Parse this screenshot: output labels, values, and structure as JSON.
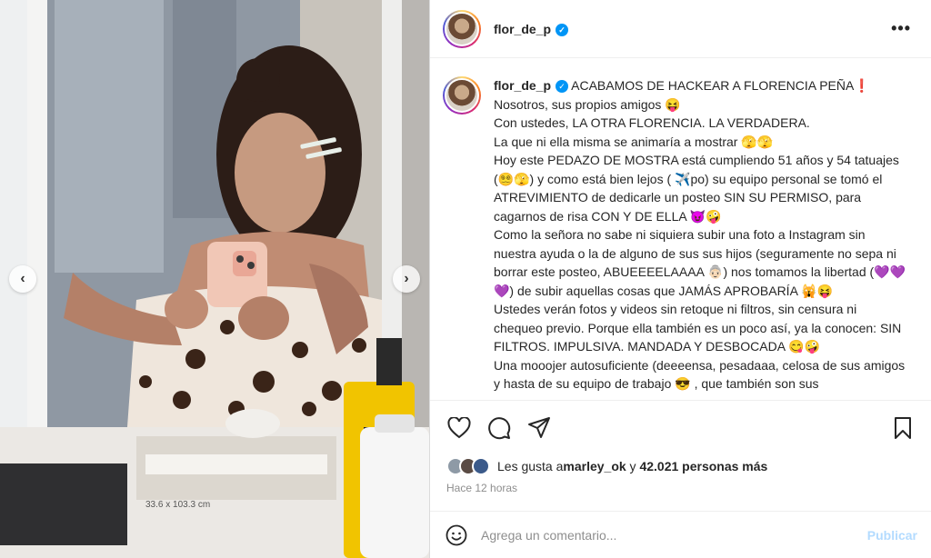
{
  "post": {
    "username": "flor_de_p",
    "more_label": "•••",
    "caption_lines": [
      "ACABAMOS DE HACKEAR A FLORENCIA PEÑA❗",
      "Nosotros, sus propios amigos 😝",
      "Con ustedes, LA OTRA FLORENCIA. LA VERDADERA.",
      "La que ni ella misma se animaría a mostrar 🫣🫣",
      "Hoy este PEDAZO DE MOSTRA está cumpliendo 51 años y 54 tatuajes (😵‍💫🫣) y como está bien lejos ( ✈️po) su equipo personal se tomó el ATREVIMIENTO de dedicarle un posteo SIN SU PERMISO, para cagarnos de risa CON Y DE ELLA 😈🤪",
      "Como la señora no sabe ni siquiera subir una foto a Instagram sin nuestra ayuda o la de alguno de sus sus hijos (seguramente no sepa ni borrar este posteo, ABUEEEELAAAA 👵🏻) nos tomamos la libertad (💜💜💜) de subir aquellas cosas que JAMÁS APROBARÍA 🙀😝",
      "Ustedes verán fotos y videos sin retoque ni filtros, sin censura ni chequeo previo. Porque ella también es un poco así, ya la conocen: SIN FILTROS. IMPULSIVA. MANDADA Y DESBOCADA 😋🤪",
      "Una mooojer autosuficiente (deeeensa, pesadaaa, celosa de sus amigos y hasta de su equipo de trabajo 😎 , que también son sus"
    ],
    "likes": {
      "prefix": "Les gusta a ",
      "user": "marley_ok",
      "middle": " y ",
      "count": "42.021 personas más"
    },
    "time": "Hace 12 horas"
  },
  "comment": {
    "placeholder": "Agrega un comentario...",
    "publish_label": "Publicar"
  },
  "media": {
    "measure_label": "33.6 x 103.3 cm",
    "prev_label": "‹",
    "next_label": "›"
  },
  "icons": {
    "like": "heart-icon",
    "comment": "comment-icon",
    "share": "share-icon",
    "save": "bookmark-icon",
    "emoji": "emoji-icon",
    "verified": "verified-badge-icon"
  },
  "colors": {
    "accent": "#0095f6",
    "publish_disabled": "#b3dbff",
    "muted": "#8e8e8e"
  }
}
